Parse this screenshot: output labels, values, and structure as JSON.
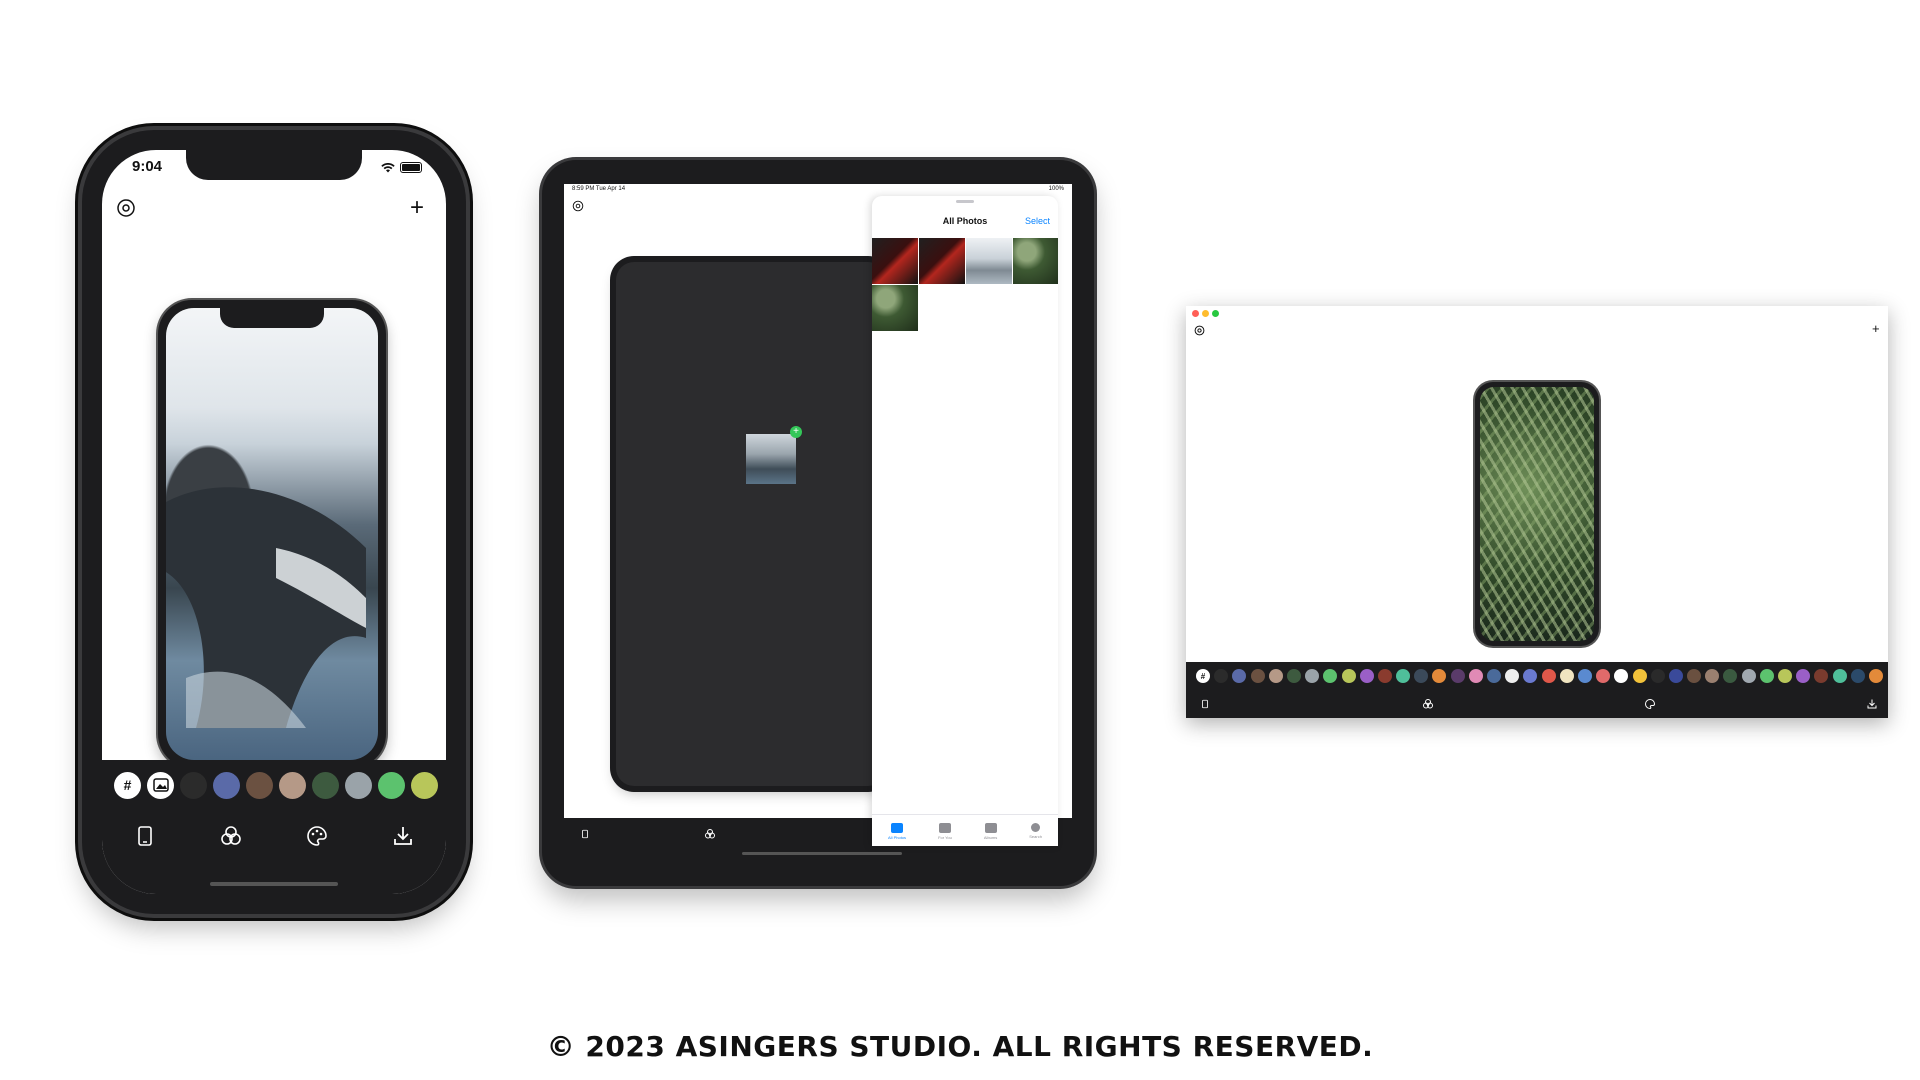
{
  "iphone": {
    "time": "9:04",
    "icons": {
      "settings": "gear-icon",
      "add": "plus-icon"
    },
    "add_label": "+",
    "palette": [
      "#2b2b2b",
      "#5a6aa8",
      "#6b5141",
      "#b59987",
      "#3d5a3f",
      "#9aa3a9",
      "#5cc26e",
      "#b8c65a"
    ],
    "palette_tool_hex": "#",
    "toolbar": [
      "device-icon",
      "filters-icon",
      "palette-icon",
      "download-icon"
    ]
  },
  "ipad": {
    "status_time": "8:59 PM  Tue Apr 14",
    "status_right": "100%",
    "picker": {
      "title": "All Photos",
      "select": "Select",
      "tabs": [
        "All Photos",
        "For You",
        "Albums",
        "Search"
      ]
    }
  },
  "mac": {
    "add_label": "+",
    "palette": [
      "#2b2b2b",
      "#5a6aa8",
      "#6b5141",
      "#b59987",
      "#3d5a3f",
      "#9aa3a9",
      "#5cc26e",
      "#b8c65a",
      "#9a5fc7",
      "#8a3b2e",
      "#4fbf9a",
      "#3b4a5a",
      "#e38a3a",
      "#5a3b6a",
      "#e08ab5",
      "#4a6a9a",
      "#eeeeee",
      "#6a7ad0",
      "#e0584a",
      "#f0e4c0",
      "#5a8ad0",
      "#e06a6a",
      "#ffffff",
      "#f2c23a",
      "#2a2a2a",
      "#3a4a9a",
      "#6a5040",
      "#9a8070",
      "#3a5a40",
      "#a0a8b0",
      "#5cc26e",
      "#b8c65a",
      "#9a5fc7",
      "#7a3b2e",
      "#4fbf9a",
      "#2b4a6a",
      "#e38a3a"
    ]
  },
  "copyright": "© 2023 ASINGERS STUDIO. ALL RIGHTS RESERVED."
}
